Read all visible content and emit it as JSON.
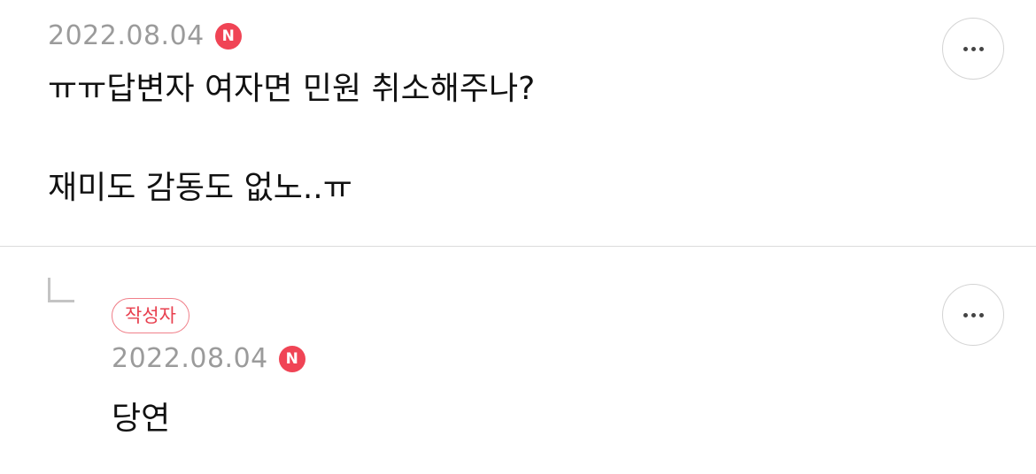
{
  "comments": [
    {
      "date": "2022.08.04",
      "new_badge": "N",
      "text": "ㅠㅠ답변자 여자면 민원 취소해주나?\n\n재미도 감동도 없노..ㅠ",
      "more_icon": "more-horizontal-icon"
    }
  ],
  "reply": {
    "author_badge": "작성자",
    "date": "2022.08.04",
    "new_badge": "N",
    "text": "당연",
    "reply_icon": "reply-arrow-icon",
    "more_icon": "more-horizontal-icon"
  },
  "colors": {
    "badge_red": "#f04455",
    "author_badge_text": "#e8404f",
    "date_gray": "#9b9b9b",
    "divider": "#dcdcdc"
  }
}
